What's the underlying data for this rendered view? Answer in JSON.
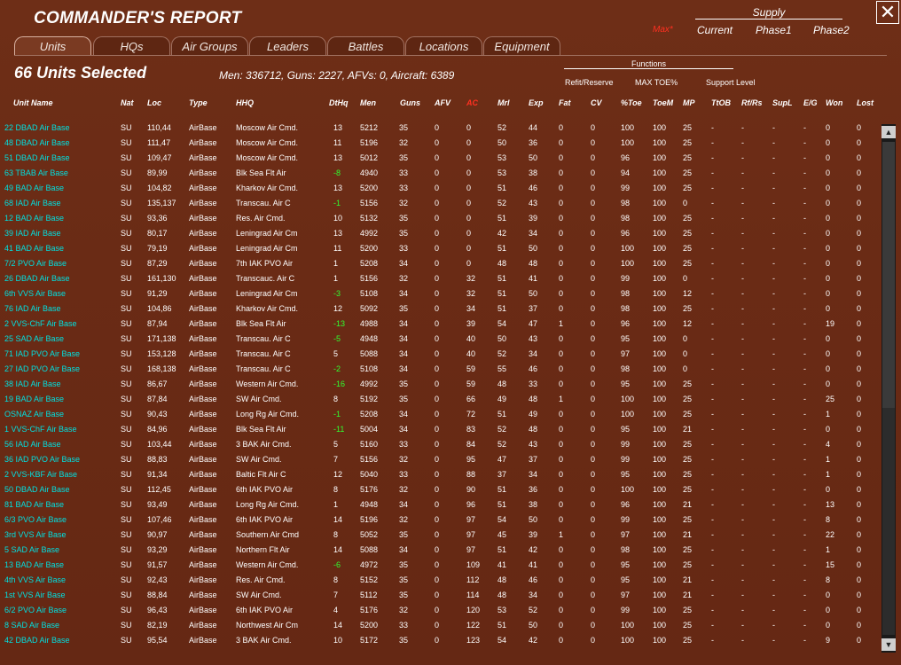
{
  "window": {
    "title": "COMMANDER'S REPORT",
    "close_icon": "close-icon"
  },
  "supply": {
    "title": "Supply",
    "max_label": "Max*",
    "columns": [
      "Current",
      "Phase1",
      "Phase2"
    ]
  },
  "tabs": [
    "Units",
    "HQs",
    "Air Groups",
    "Leaders",
    "Battles",
    "Locations",
    "Equipment"
  ],
  "active_tab": "Units",
  "selection": {
    "label": "66 Units Selected",
    "summary": "Men: 336712, Guns: 2227, AFVs: 0, Aircraft: 6389"
  },
  "functions": {
    "title": "Functions",
    "items": [
      "Refit/Reserve",
      "MAX TOE%",
      "Support Level"
    ]
  },
  "columns": [
    "Unit Name",
    "Nat",
    "Loc",
    "Type",
    "HHQ",
    "DtHq",
    "Men",
    "Guns",
    "AFV",
    "AC",
    "Mrl",
    "Exp",
    "Fat",
    "CV",
    "%Toe",
    "ToeM",
    "MP",
    "TtOB",
    "Rf/Rs",
    "SupL",
    "E/G",
    "Won",
    "Lost"
  ],
  "rows": [
    [
      "22 DBAD Air Base",
      "SU",
      "110,44",
      "AirBase",
      "Moscow Air Cmd.",
      "13",
      "5212",
      "35",
      "0",
      "0",
      "52",
      "44",
      "0",
      "0",
      "100",
      "100",
      "25",
      "-",
      "-",
      "-",
      "-",
      "0",
      "0"
    ],
    [
      "48 DBAD Air Base",
      "SU",
      "111,47",
      "AirBase",
      "Moscow Air Cmd.",
      "11",
      "5196",
      "32",
      "0",
      "0",
      "50",
      "36",
      "0",
      "0",
      "100",
      "100",
      "25",
      "-",
      "-",
      "-",
      "-",
      "0",
      "0"
    ],
    [
      "51 DBAD Air Base",
      "SU",
      "109,47",
      "AirBase",
      "Moscow Air Cmd.",
      "13",
      "5012",
      "35",
      "0",
      "0",
      "53",
      "50",
      "0",
      "0",
      "96",
      "100",
      "25",
      "-",
      "-",
      "-",
      "-",
      "0",
      "0"
    ],
    [
      "63 TBAB Air Base",
      "SU",
      "89,99",
      "AirBase",
      "Blk Sea Flt Air",
      "-8",
      "4940",
      "33",
      "0",
      "0",
      "53",
      "38",
      "0",
      "0",
      "94",
      "100",
      "25",
      "-",
      "-",
      "-",
      "-",
      "0",
      "0"
    ],
    [
      "49 BAD Air Base",
      "SU",
      "104,82",
      "AirBase",
      "Kharkov Air Cmd.",
      "13",
      "5200",
      "33",
      "0",
      "0",
      "51",
      "46",
      "0",
      "0",
      "99",
      "100",
      "25",
      "-",
      "-",
      "-",
      "-",
      "0",
      "0"
    ],
    [
      "68 IAD Air Base",
      "SU",
      "135,137",
      "AirBase",
      "Transcau. Air C",
      "-1",
      "5156",
      "32",
      "0",
      "0",
      "52",
      "43",
      "0",
      "0",
      "98",
      "100",
      "0",
      "-",
      "-",
      "-",
      "-",
      "0",
      "0"
    ],
    [
      "12 BAD Air Base",
      "SU",
      "93,36",
      "AirBase",
      "Res. Air Cmd.",
      "10",
      "5132",
      "35",
      "0",
      "0",
      "51",
      "39",
      "0",
      "0",
      "98",
      "100",
      "25",
      "-",
      "-",
      "-",
      "-",
      "0",
      "0"
    ],
    [
      "39 IAD Air Base",
      "SU",
      "80,17",
      "AirBase",
      "Leningrad Air Cm",
      "13",
      "4992",
      "35",
      "0",
      "0",
      "42",
      "34",
      "0",
      "0",
      "96",
      "100",
      "25",
      "-",
      "-",
      "-",
      "-",
      "0",
      "0"
    ],
    [
      "41 BAD Air Base",
      "SU",
      "79,19",
      "AirBase",
      "Leningrad Air Cm",
      "11",
      "5200",
      "33",
      "0",
      "0",
      "51",
      "50",
      "0",
      "0",
      "100",
      "100",
      "25",
      "-",
      "-",
      "-",
      "-",
      "0",
      "0"
    ],
    [
      "7/2 PVO Air Base",
      "SU",
      "87,29",
      "AirBase",
      "7th IAK PVO Air",
      "1",
      "5208",
      "34",
      "0",
      "0",
      "48",
      "48",
      "0",
      "0",
      "100",
      "100",
      "25",
      "-",
      "-",
      "-",
      "-",
      "0",
      "0"
    ],
    [
      "26 DBAD Air Base",
      "SU",
      "161,130",
      "AirBase",
      "Transcauc. Air C",
      "1",
      "5156",
      "32",
      "0",
      "32",
      "51",
      "41",
      "0",
      "0",
      "99",
      "100",
      "0",
      "-",
      "-",
      "-",
      "-",
      "0",
      "0"
    ],
    [
      "6th VVS Air Base",
      "SU",
      "91,29",
      "AirBase",
      "Leningrad Air Cm",
      "-3",
      "5108",
      "34",
      "0",
      "32",
      "51",
      "50",
      "0",
      "0",
      "98",
      "100",
      "12",
      "-",
      "-",
      "-",
      "-",
      "0",
      "0"
    ],
    [
      "76 IAD Air Base",
      "SU",
      "104,86",
      "AirBase",
      "Kharkov Air Cmd.",
      "12",
      "5092",
      "35",
      "0",
      "34",
      "51",
      "37",
      "0",
      "0",
      "98",
      "100",
      "25",
      "-",
      "-",
      "-",
      "-",
      "0",
      "0"
    ],
    [
      "2 VVS-ChF Air Base",
      "SU",
      "87,94",
      "AirBase",
      "Blk Sea Flt Air",
      "-13",
      "4988",
      "34",
      "0",
      "39",
      "54",
      "47",
      "1",
      "0",
      "96",
      "100",
      "12",
      "-",
      "-",
      "-",
      "-",
      "19",
      "0"
    ],
    [
      "25 SAD Air Base",
      "SU",
      "171,138",
      "AirBase",
      "Transcau. Air C",
      "-5",
      "4948",
      "34",
      "0",
      "40",
      "50",
      "43",
      "0",
      "0",
      "95",
      "100",
      "0",
      "-",
      "-",
      "-",
      "-",
      "0",
      "0"
    ],
    [
      "71 IAD PVO Air Base",
      "SU",
      "153,128",
      "AirBase",
      "Transcau. Air C",
      "5",
      "5088",
      "34",
      "0",
      "40",
      "52",
      "34",
      "0",
      "0",
      "97",
      "100",
      "0",
      "-",
      "-",
      "-",
      "-",
      "0",
      "0"
    ],
    [
      "27 IAD PVO Air Base",
      "SU",
      "168,138",
      "AirBase",
      "Transcau. Air C",
      "-2",
      "5108",
      "34",
      "0",
      "59",
      "55",
      "46",
      "0",
      "0",
      "98",
      "100",
      "0",
      "-",
      "-",
      "-",
      "-",
      "0",
      "0"
    ],
    [
      "38 IAD Air Base",
      "SU",
      "86,67",
      "AirBase",
      "Western Air Cmd.",
      "-16",
      "4992",
      "35",
      "0",
      "59",
      "48",
      "33",
      "0",
      "0",
      "95",
      "100",
      "25",
      "-",
      "-",
      "-",
      "-",
      "0",
      "0"
    ],
    [
      "19 BAD Air Base",
      "SU",
      "87,84",
      "AirBase",
      "SW Air Cmd.",
      "8",
      "5192",
      "35",
      "0",
      "66",
      "49",
      "48",
      "1",
      "0",
      "100",
      "100",
      "25",
      "-",
      "-",
      "-",
      "-",
      "25",
      "0"
    ],
    [
      "OSNAZ Air Base",
      "SU",
      "90,43",
      "AirBase",
      "Long Rg Air Cmd.",
      "-1",
      "5208",
      "34",
      "0",
      "72",
      "51",
      "49",
      "0",
      "0",
      "100",
      "100",
      "25",
      "-",
      "-",
      "-",
      "-",
      "1",
      "0"
    ],
    [
      "1 VVS-ChF Air Base",
      "SU",
      "84,96",
      "AirBase",
      "Blk Sea Flt Air",
      "-11",
      "5004",
      "34",
      "0",
      "83",
      "52",
      "48",
      "0",
      "0",
      "95",
      "100",
      "21",
      "-",
      "-",
      "-",
      "-",
      "0",
      "0"
    ],
    [
      "56 IAD Air Base",
      "SU",
      "103,44",
      "AirBase",
      "3 BAK Air Cmd.",
      "5",
      "5160",
      "33",
      "0",
      "84",
      "52",
      "43",
      "0",
      "0",
      "99",
      "100",
      "25",
      "-",
      "-",
      "-",
      "-",
      "4",
      "0"
    ],
    [
      "36 IAD PVO Air Base",
      "SU",
      "88,83",
      "AirBase",
      "SW Air Cmd.",
      "7",
      "5156",
      "32",
      "0",
      "95",
      "47",
      "37",
      "0",
      "0",
      "99",
      "100",
      "25",
      "-",
      "-",
      "-",
      "-",
      "1",
      "0"
    ],
    [
      "2 VVS-KBF Air Base",
      "SU",
      "91,34",
      "AirBase",
      "Baltic Flt Air C",
      "12",
      "5040",
      "33",
      "0",
      "88",
      "37",
      "34",
      "0",
      "0",
      "95",
      "100",
      "25",
      "-",
      "-",
      "-",
      "-",
      "1",
      "0"
    ],
    [
      "50 DBAD Air Base",
      "SU",
      "112,45",
      "AirBase",
      "6th IAK PVO Air",
      "8",
      "5176",
      "32",
      "0",
      "90",
      "51",
      "36",
      "0",
      "0",
      "100",
      "100",
      "25",
      "-",
      "-",
      "-",
      "-",
      "0",
      "0"
    ],
    [
      "81 BAD Air Base",
      "SU",
      "93,49",
      "AirBase",
      "Long Rg Air Cmd.",
      "1",
      "4948",
      "34",
      "0",
      "96",
      "51",
      "38",
      "0",
      "0",
      "96",
      "100",
      "21",
      "-",
      "-",
      "-",
      "-",
      "13",
      "0"
    ],
    [
      "6/3 PVO Air Base",
      "SU",
      "107,46",
      "AirBase",
      "6th IAK PVO Air",
      "14",
      "5196",
      "32",
      "0",
      "97",
      "54",
      "50",
      "0",
      "0",
      "99",
      "100",
      "25",
      "-",
      "-",
      "-",
      "-",
      "8",
      "0"
    ],
    [
      "3rd VVS Air Base",
      "SU",
      "90,97",
      "AirBase",
      "Southern Air Cmd",
      "8",
      "5052",
      "35",
      "0",
      "97",
      "45",
      "39",
      "1",
      "0",
      "97",
      "100",
      "21",
      "-",
      "-",
      "-",
      "-",
      "22",
      "0"
    ],
    [
      "5 SAD Air Base",
      "SU",
      "93,29",
      "AirBase",
      "Northern Flt Air",
      "14",
      "5088",
      "34",
      "0",
      "97",
      "51",
      "42",
      "0",
      "0",
      "98",
      "100",
      "25",
      "-",
      "-",
      "-",
      "-",
      "1",
      "0"
    ],
    [
      "13 BAD Air Base",
      "SU",
      "91,57",
      "AirBase",
      "Western Air Cmd.",
      "-6",
      "4972",
      "35",
      "0",
      "109",
      "41",
      "41",
      "0",
      "0",
      "95",
      "100",
      "25",
      "-",
      "-",
      "-",
      "-",
      "15",
      "0"
    ],
    [
      "4th VVS Air Base",
      "SU",
      "92,43",
      "AirBase",
      "Res. Air Cmd.",
      "8",
      "5152",
      "35",
      "0",
      "112",
      "48",
      "46",
      "0",
      "0",
      "95",
      "100",
      "21",
      "-",
      "-",
      "-",
      "-",
      "8",
      "0"
    ],
    [
      "1st VVS Air Base",
      "SU",
      "88,84",
      "AirBase",
      "SW Air Cmd.",
      "7",
      "5112",
      "35",
      "0",
      "114",
      "48",
      "34",
      "0",
      "0",
      "97",
      "100",
      "21",
      "-",
      "-",
      "-",
      "-",
      "0",
      "0"
    ],
    [
      "6/2 PVO Air Base",
      "SU",
      "96,43",
      "AirBase",
      "6th IAK PVO Air",
      "4",
      "5176",
      "32",
      "0",
      "120",
      "53",
      "52",
      "0",
      "0",
      "99",
      "100",
      "25",
      "-",
      "-",
      "-",
      "-",
      "0",
      "0"
    ],
    [
      "8 SAD Air Base",
      "SU",
      "82,19",
      "AirBase",
      "Northwest Air Cm",
      "14",
      "5200",
      "33",
      "0",
      "122",
      "51",
      "50",
      "0",
      "0",
      "100",
      "100",
      "25",
      "-",
      "-",
      "-",
      "-",
      "0",
      "0"
    ],
    [
      "42 DBAD Air Base",
      "SU",
      "95,54",
      "AirBase",
      "3 BAK Air Cmd.",
      "10",
      "5172",
      "35",
      "0",
      "123",
      "54",
      "42",
      "0",
      "0",
      "100",
      "100",
      "25",
      "-",
      "-",
      "-",
      "-",
      "9",
      "0"
    ]
  ],
  "scrollbar": {
    "up_icon": "arrow-up-icon",
    "down_icon": "arrow-down-icon"
  }
}
